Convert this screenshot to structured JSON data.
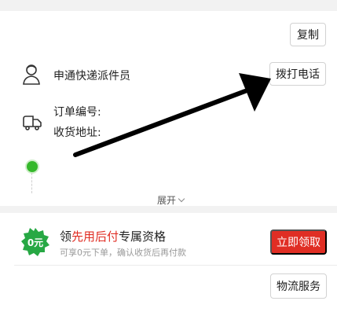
{
  "tracking": {
    "copy_label": "复制",
    "courier_label": "申通快递派件员",
    "call_label": "拨打电话",
    "order_no_label": "订单编号:",
    "address_label": "收货地址:",
    "expand_label": "展开"
  },
  "promo": {
    "badge_text": "0元",
    "title_prefix": "领",
    "title_highlight": "先用后付",
    "title_suffix": "专属资格",
    "subtitle": "可享0元下单，确认收货后再付款",
    "claim_label": "立即领取"
  },
  "footer": {
    "logistics_label": "物流服务"
  },
  "colors": {
    "accent_red": "#e02e24",
    "badge_green": "#27a844",
    "track_green": "#35b82b",
    "arrow": "#000000"
  },
  "icons": {
    "courier": "person-icon",
    "shipment": "truck-icon",
    "expand": "chevron-down-icon",
    "annotation": "arrow-icon"
  }
}
